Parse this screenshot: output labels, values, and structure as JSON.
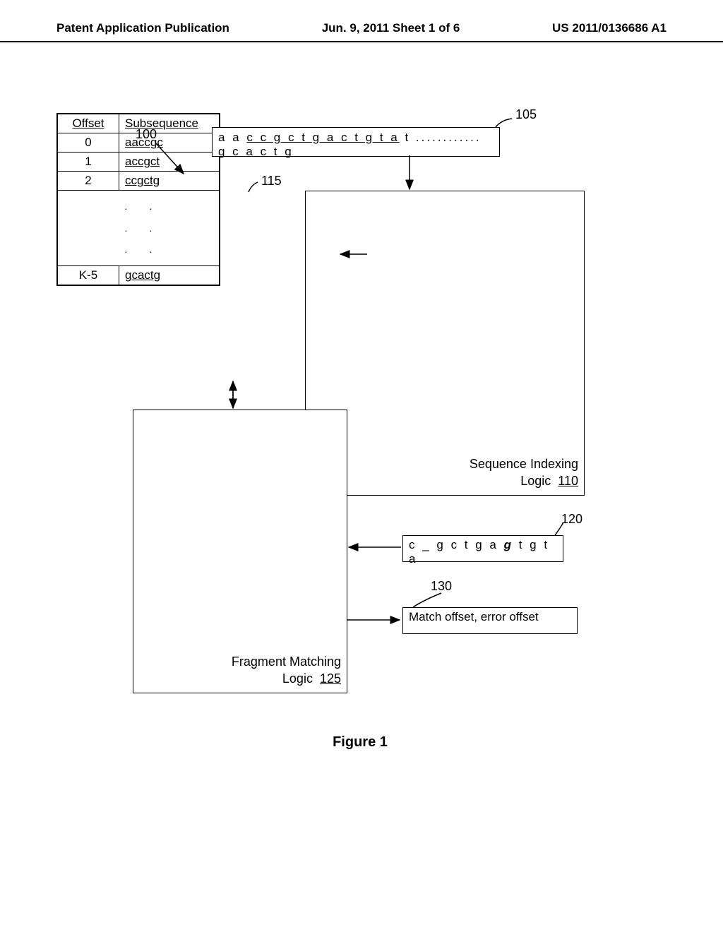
{
  "header": {
    "left": "Patent Application Publication",
    "center": "Jun. 9, 2011  Sheet 1 of 6",
    "right": "US 2011/0136686 A1"
  },
  "labels": {
    "ref100": "100",
    "ref105": "105",
    "ref115": "115",
    "ref120": "120",
    "ref130": "130"
  },
  "sequence": {
    "prefix": "a a ",
    "underlined": "c c g c t g a c t g t a",
    "suffix": " t ............ g c a c t g"
  },
  "table": {
    "header_offset": "Offset",
    "header_subseq": "Subsequence",
    "rows": [
      {
        "offset": "0",
        "subseq": "aaccgc"
      },
      {
        "offset": "1",
        "subseq": "accgct"
      },
      {
        "offset": "2",
        "subseq": "ccgctg"
      }
    ],
    "last": {
      "offset": "K-5",
      "subseq": "gcactg"
    }
  },
  "indexing": {
    "title": "Sequence Indexing",
    "logic": "Logic",
    "num": "110"
  },
  "matching": {
    "title": "Fragment Matching",
    "logic": "Logic",
    "num": "125"
  },
  "fragment": {
    "pre": "c _ g c t g a ",
    "ital": "g",
    "post": " t g t a"
  },
  "result": "Match offset, error offset",
  "caption": "Figure 1"
}
